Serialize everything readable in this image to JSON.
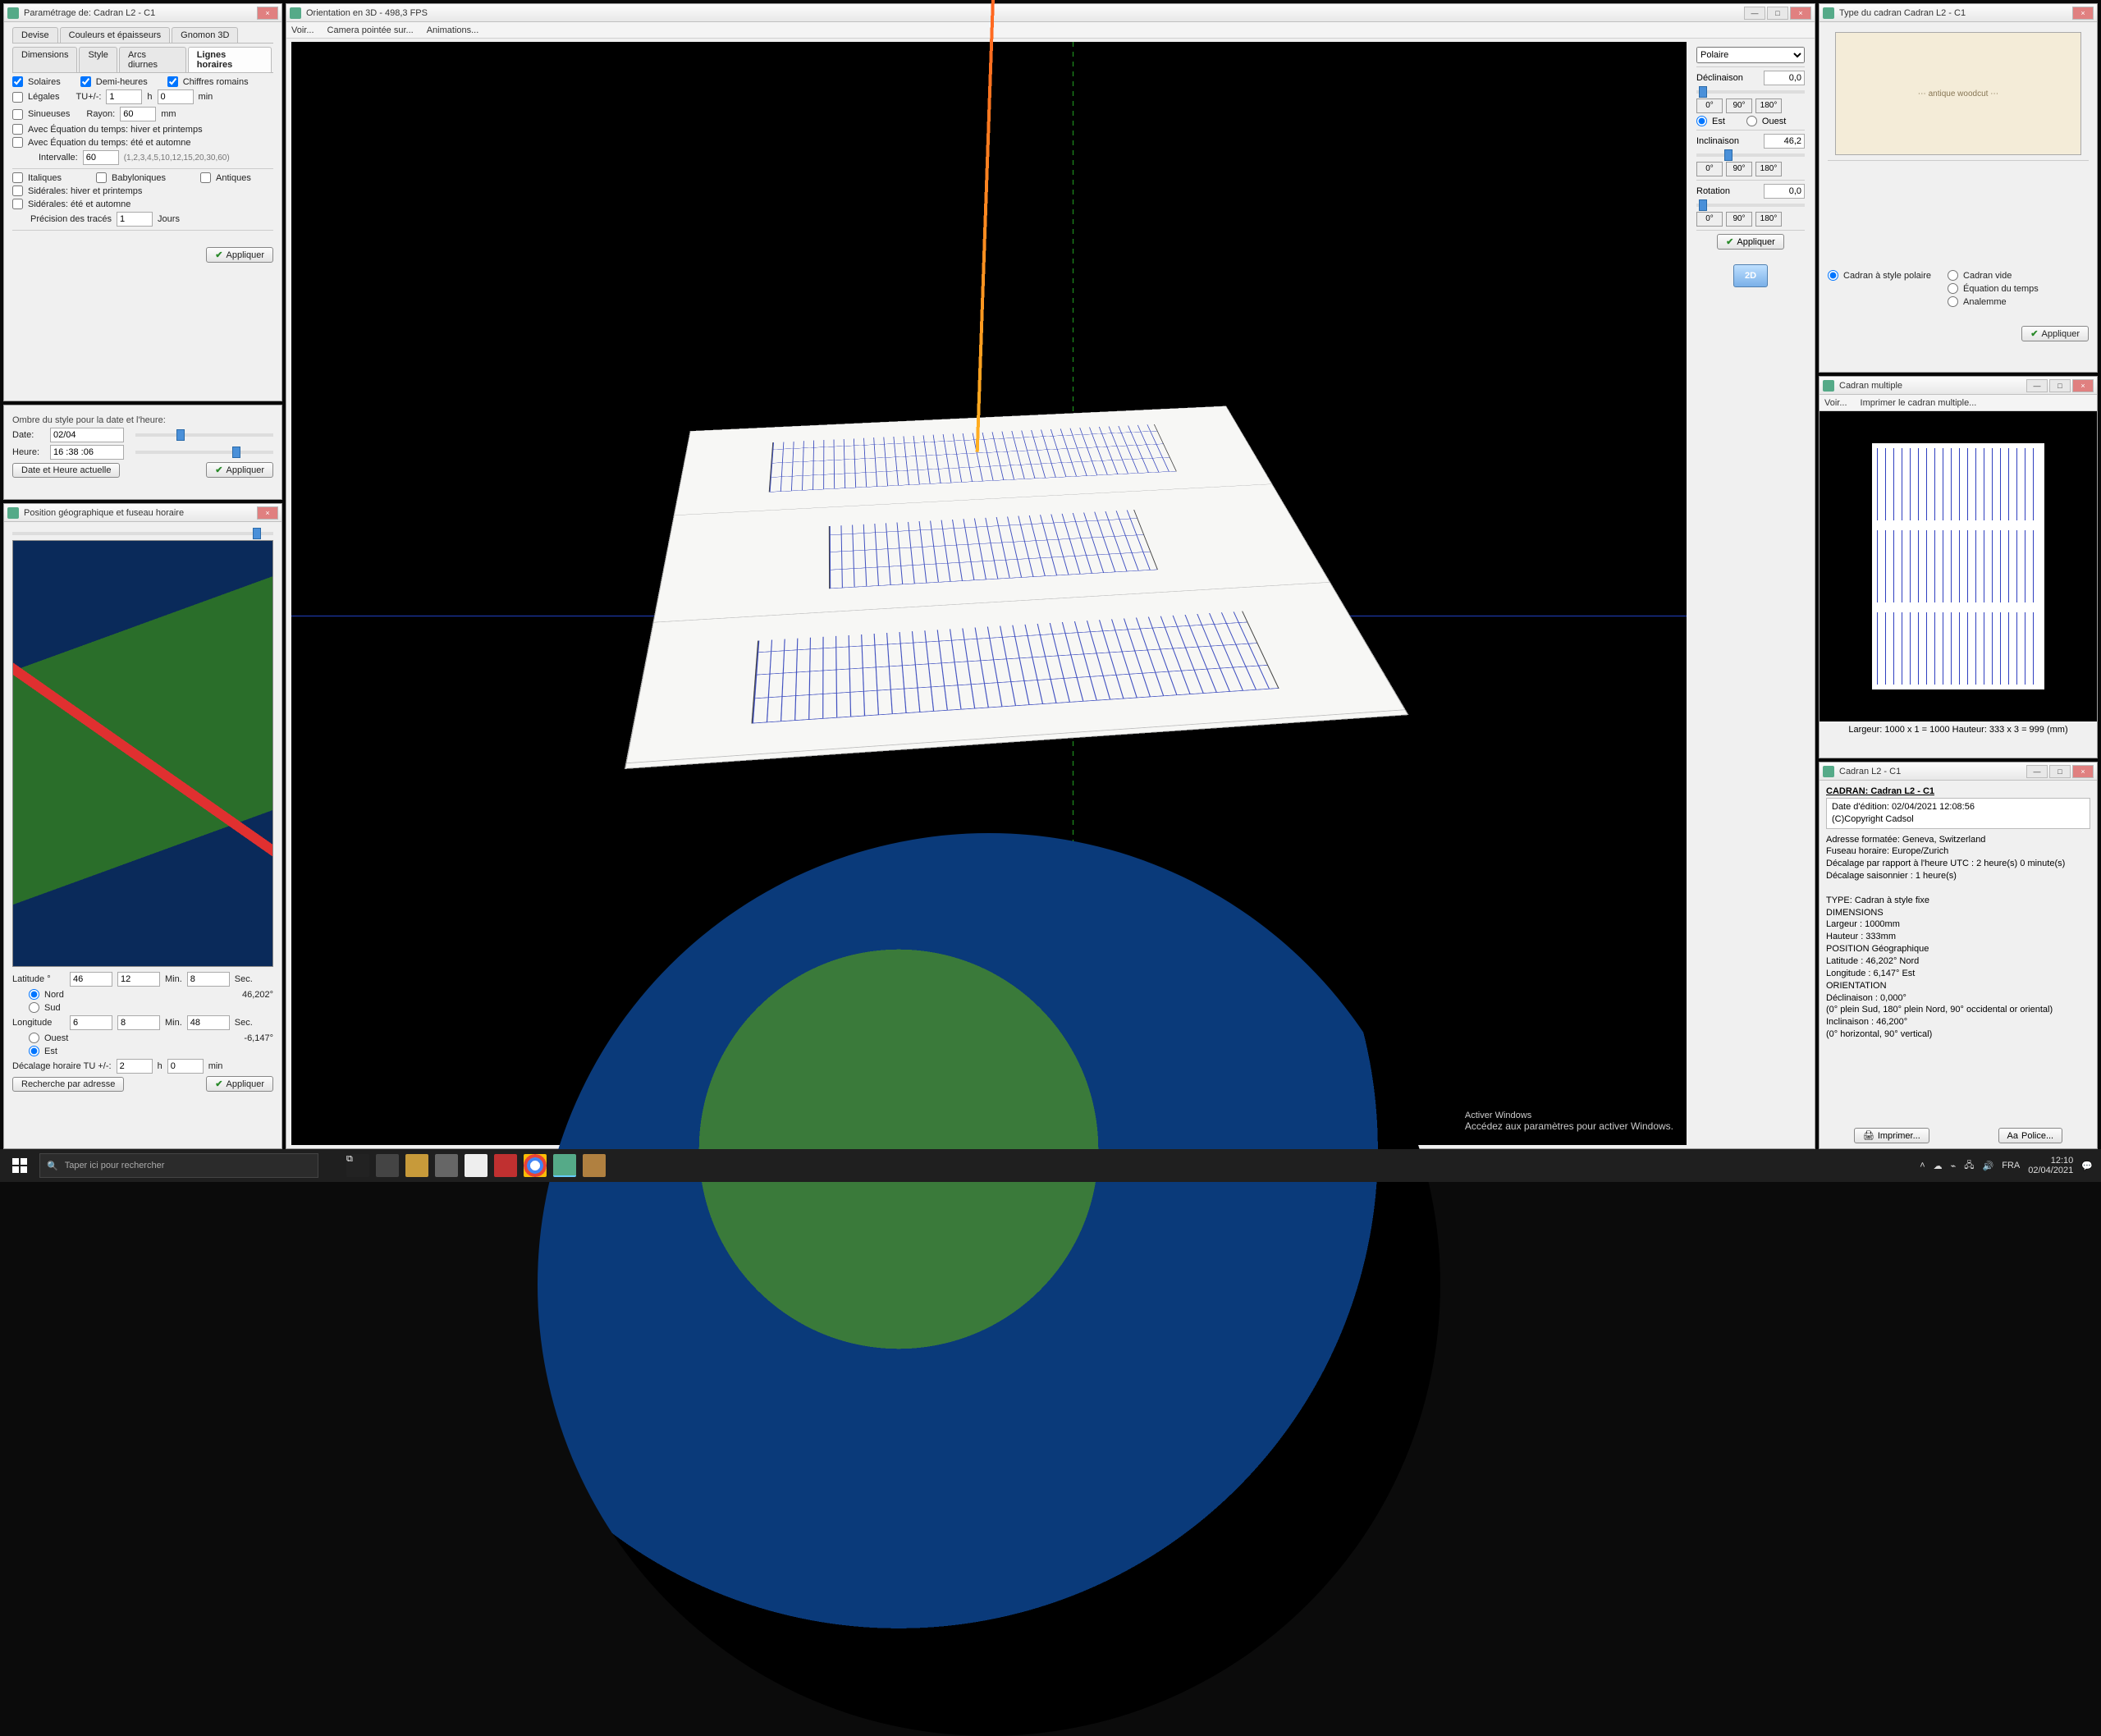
{
  "param_panel": {
    "title": "Paramétrage de: Cadran L2 - C1",
    "tabs_row1": [
      "Devise",
      "Couleurs et épaisseurs",
      "Gnomon 3D"
    ],
    "tabs_row2": [
      "Dimensions",
      "Style",
      "Arcs diurnes",
      "Lignes horaires"
    ],
    "active_tab": "Lignes horaires",
    "chk_solaires": "Solaires",
    "chk_demiheures": "Demi-heures",
    "chk_chiffres": "Chiffres romains",
    "chk_legales": "Légales",
    "tu_label": "TU+/-:",
    "tu_h": "1",
    "tu_m": "0",
    "tu_unit_h": "h",
    "tu_unit_min": "min",
    "chk_sinueuses": "Sinueuses",
    "rayon_label": "Rayon:",
    "rayon_val": "60",
    "rayon_unit": "mm",
    "chk_eq_hiver": "Avec Équation du temps: hiver et printemps",
    "chk_eq_ete": "Avec Équation du temps: été et automne",
    "intervalle_label": "Intervalle:",
    "intervalle_val": "60",
    "intervalle_hint": "(1,2,3,4,5,10,12,15,20,30,60)",
    "chk_italiques": "Italiques",
    "chk_babylon": "Babyloniques",
    "chk_antiques": "Antiques",
    "chk_sid_hiver": "Sidérales: hiver et printemps",
    "chk_sid_ete": "Sidérales: été et automne",
    "precision_label": "Précision des tracés",
    "precision_val": "1",
    "precision_unit": "Jours",
    "apply": "Appliquer"
  },
  "shadow_panel": {
    "title": "Ombre du style pour la date et l'heure:",
    "date_label": "Date:",
    "date_val": "02/04",
    "heure_label": "Heure:",
    "heure_val": "16 :38 :06",
    "now_btn": "Date et Heure actuelle",
    "apply": "Appliquer"
  },
  "geo_panel": {
    "title": "Position géographique et fuseau horaire",
    "lat_label": "Latitude °",
    "lat_d": "46",
    "lat_m": "12",
    "lat_s": "8",
    "min_label": "Min.",
    "sec_label": "Sec.",
    "nord": "Nord",
    "sud": "Sud",
    "lat_dec": "46,202°",
    "lon_label": "Longitude",
    "lon_d": "6",
    "lon_m": "8",
    "lon_s": "48",
    "ouest": "Ouest",
    "est": "Est",
    "lon_dec": "-6,147°",
    "decalage_label": "Décalage horaire TU +/-:",
    "dec_h": "2",
    "dec_m": "0",
    "dec_unit_h": "h",
    "dec_unit_min": "min",
    "search_btn": "Recherche par adresse",
    "apply": "Appliquer"
  },
  "view3d": {
    "title": "Orientation  en  3D - 498,3 FPS",
    "menu": [
      "Voir...",
      "Camera pointée sur...",
      "Animations..."
    ],
    "watermark_l1": "Activer Windows",
    "watermark_l2": "Accédez aux paramètres pour activer Windows.",
    "twod": "2D"
  },
  "orient_panel": {
    "forme": "Polaire",
    "declin_label": "Déclinaison",
    "declin_val": "0,0",
    "inclin_label": "Inclinaison",
    "inclin_val": "46,2",
    "rot_label": "Rotation",
    "rot_val": "0,0",
    "deg0": "0°",
    "deg90": "90°",
    "deg180": "180°",
    "est": "Est",
    "ouest": "Ouest",
    "apply": "Appliquer"
  },
  "type_panel": {
    "title": "Type du cadran Cadran L2 - C1",
    "opt_polar": "Cadran à style polaire",
    "opt_vide": "Cadran vide",
    "opt_eq": "Équation du temps",
    "opt_ana": "Analemme",
    "apply": "Appliquer"
  },
  "multi_panel": {
    "title": "Cadran multiple",
    "menu": [
      "Voir...",
      "Imprimer le cadran multiple..."
    ],
    "dims": "Largeur: 1000 x 1 = 1000      Hauteur: 333 x 3 = 999   (mm)"
  },
  "info_panel": {
    "title": "Cadran L2 - C1",
    "header": "CADRAN: Cadran L2 - C1",
    "edition": "Date d'édition: 02/04/2021 12:08:56",
    "copyright": "(C)Copyright Cadsol",
    "lines": [
      "Adresse formatée: Geneva, Switzerland",
      "Fuseau horaire: Europe/Zurich",
      "Décalage par rapport à l'heure UTC : 2 heure(s)  0 minute(s)",
      "Décalage saisonnier : 1 heure(s)",
      "",
      "TYPE: Cadran à style fixe",
      "DIMENSIONS",
      "  Largeur :   1000mm",
      "  Hauteur :   333mm",
      "POSITION Géographique",
      "  Latitude  :   46,202° Nord",
      "  Longitude :   6,147° Est",
      "ORIENTATION",
      "  Déclinaison :      0,000°",
      "(0° plein Sud, 180° plein Nord, 90° occidental or oriental)",
      "  Inclinaison :      46,200°",
      "(0° horizontal, 90° vertical)"
    ],
    "print": "Imprimer...",
    "font": "Police..."
  },
  "taskbar": {
    "search_placeholder": "Taper ici pour rechercher",
    "time": "12:10",
    "date": "02/04/2021"
  }
}
